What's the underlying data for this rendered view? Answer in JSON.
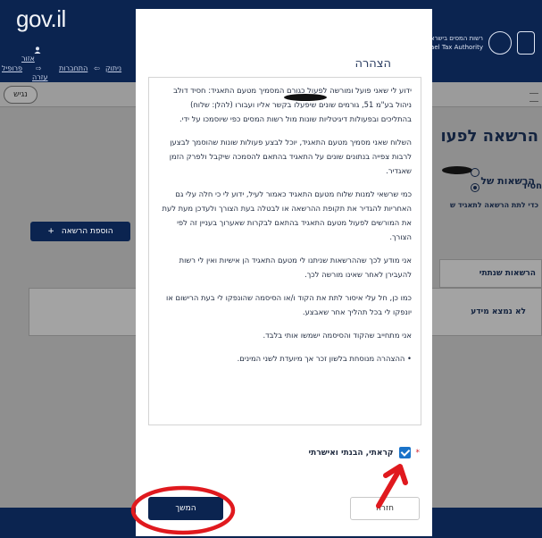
{
  "header": {
    "logo_text": "gov",
    "logo_suffix": ".il",
    "links": [
      "אזור",
      "אישי",
      "פרופיל",
      "התחברות",
      "ניתוק",
      "עזרה"
    ],
    "tax_authority_he": "רשות המסים בישראל",
    "tax_authority_en": "Israel Tax Authority"
  },
  "subbar": {
    "pill_label": "נגיש"
  },
  "page": {
    "title": "הרשאה לפעו",
    "permissions_of_label": "הרשאות של",
    "radio_selected_label": "חסיד",
    "hint": "כדי לתת הרשאה לתאגיד ש",
    "add_permission_button": "הוספת הרשאה",
    "add_icon": "+",
    "table_header": "הרשאות שנתתי",
    "no_info": "לא נמצא מידע"
  },
  "modal": {
    "title": "הצהרה",
    "paragraphs": [
      "ידוע לי שאני פועל ומורשה לפעול כגורם המסמיך מטעם התאגיד: חסיד דולב ניהול בע\"מ 51, גורמים שונים שיפעלו בקשר אליו ועבורו (להלן: שלוח) בהתליכים ובפעולות דיגיטליות שונות מול רשות המסים כפי שיוסמכו על ידי.",
      "השלוח שאני מסמיך מטעם התאגיד, יוכל לבצע פעולות שונות שהוסמך לבצען לרבות צפייה בנתונים שונים על התאגיד בהתאם להסמכה שיקבל ולפרק הזמן שאגדיר.",
      "כמי שרשאי למנות שלוח מטעם התאגיד כאמור לעיל, ידוע לי כי חלה עלי גם האחריות להגדיר את תקופת ההרשאה או לבטלה בעת הצורך ולעדכן מעת לעת את המורשים לפעול מטעם התאגיד בהתאם לבקרות שאערוך בעניין זה לפי הצורך.",
      "אני מודע לכך שההרשאות שניתנו לי מטעם התאגיד הן אישיות ואין לי רשות להעבירן לאחר שאינו מורשה לכך.",
      "כמו כן, חל עלי איסור לתת את הקוד ו/או הסיסמה שהונפקו לי בעת הרישום או יונפקו לי בכל תהליך אחר שאבצע.",
      "אני מתחייב שהקוד והסיסמה ישמשו אותי בלבד.",
      "• ההצהרה מנוסחת בלשון זכר אך מיועדת לשני המינים."
    ],
    "confirm_required_mark": "*",
    "confirm_label": "קראתי, הבנתי ואישרתי",
    "confirm_checked": true,
    "continue_button": "המשך",
    "back_button": "חזרה"
  },
  "colors": {
    "header_navy": "#0b2450",
    "checkbox_blue": "#1a73c9",
    "annotation_red": "#e0191e"
  },
  "icons": [
    "user-icon",
    "login-icon",
    "logout-icon",
    "tax-authority-logo-icon",
    "menu-icon",
    "checkmark-icon",
    "plus-icon"
  ]
}
